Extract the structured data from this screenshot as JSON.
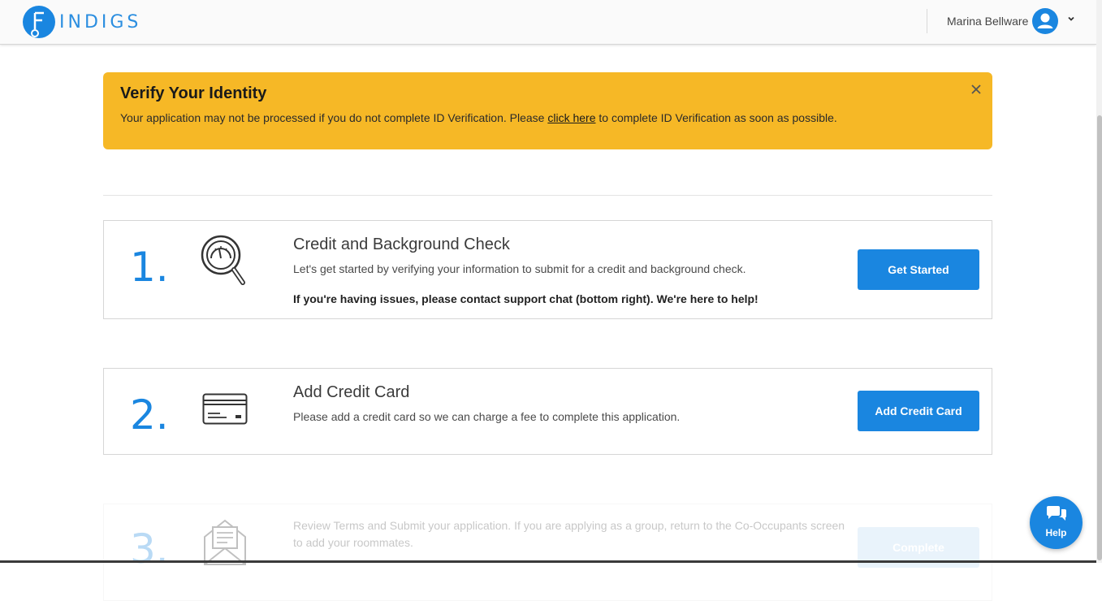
{
  "header": {
    "logo_text": "INDIGS",
    "user_name": "Marina Bellware",
    "icons": {
      "avatar": "user-circle-icon",
      "menu": "chevron-down-icon"
    }
  },
  "alert": {
    "title": "Verify Your Identity",
    "body_before": "Your application may not be processed if you do not complete ID Verification. Please ",
    "link_text": "click here",
    "body_after": " to complete ID Verification as soon as possible.",
    "color": "#f6b826"
  },
  "steps": [
    {
      "number": "1.",
      "icon": "credit-check-magnifier-icon",
      "title": "Credit and Background Check",
      "description": "Let's get started by verifying your information to submit for a credit and background check.",
      "note": "If you're having issues, please contact support chat (bottom right). We're here to help!",
      "button": "Get Started"
    },
    {
      "number": "2.",
      "icon": "credit-card-icon",
      "title": "Add Credit Card",
      "description": "Please add a credit card so we can charge a fee to complete this application.",
      "button": "Add Credit Card"
    },
    {
      "number": "3.",
      "icon": "envelope-document-icon",
      "description": "Review Terms and Submit your application. If you are applying as a group, return to the Co-Occupants screen to add your roommates.",
      "button": "Complete",
      "disabled": true
    }
  ],
  "help": {
    "label": "Help",
    "icon": "chat-bubbles-icon"
  },
  "colors": {
    "primary": "#1a86e0",
    "alert": "#f6b826"
  }
}
